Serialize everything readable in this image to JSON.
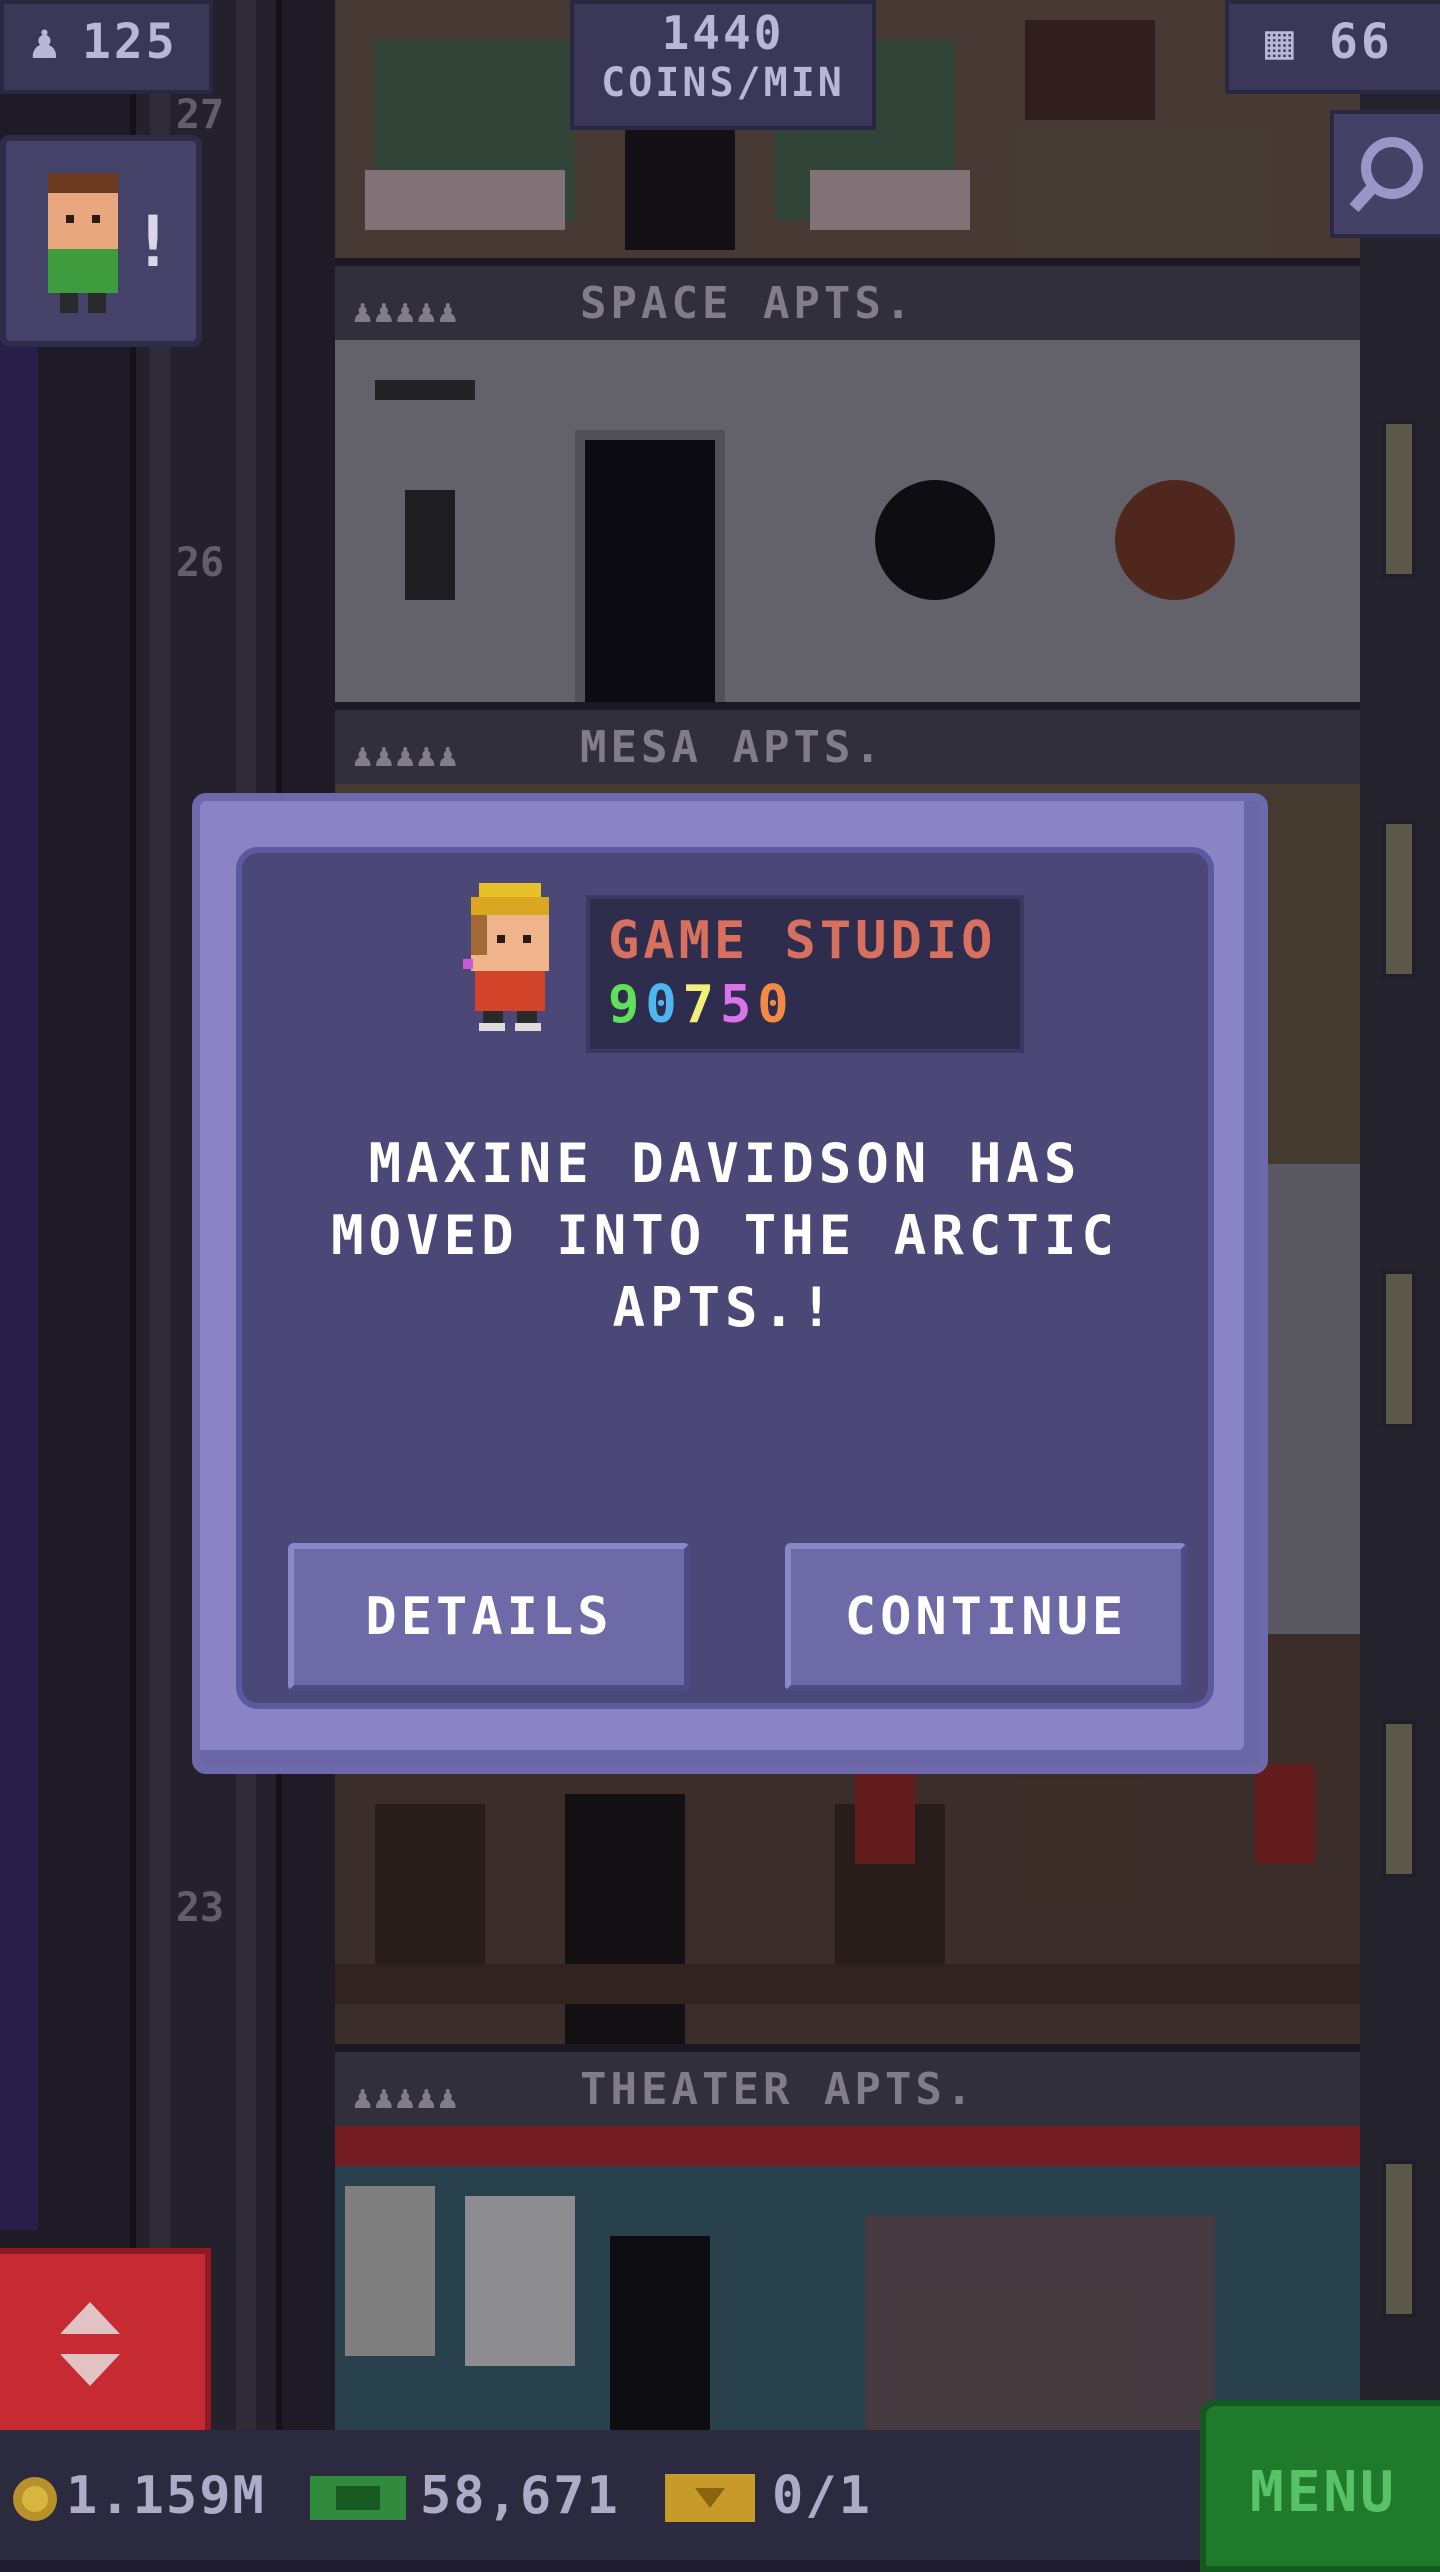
{
  "hud": {
    "population": "125",
    "coins_per_min_value": "1440",
    "coins_per_min_unit": "COINS/MIN",
    "stories": "66"
  },
  "tower": {
    "floor_numbers": [
      "27",
      "26",
      "23"
    ],
    "floor_labels": [
      "SPACE APTS.",
      "MESA APTS.",
      "THEATER APTS."
    ],
    "person_icons": "♟♟♟♟♟"
  },
  "dialog": {
    "studio_name": "GAME STUDIO",
    "studio_score_digits": [
      "9",
      "0",
      "7",
      "5",
      "0"
    ],
    "studio_score_colors": [
      "#5fe05a",
      "#4fb6f0",
      "#f2f07a",
      "#d874e8",
      "#f28a46"
    ],
    "message": "MAXINE DAVIDSON HAS MOVED INTO THE ARCTIC APTS.!",
    "details_label": "DETAILS",
    "continue_label": "CONTINUE"
  },
  "bottom_bar": {
    "coins": "1.159M",
    "bux": "58,671",
    "tickets": "0/1",
    "menu_label": "MENU"
  }
}
